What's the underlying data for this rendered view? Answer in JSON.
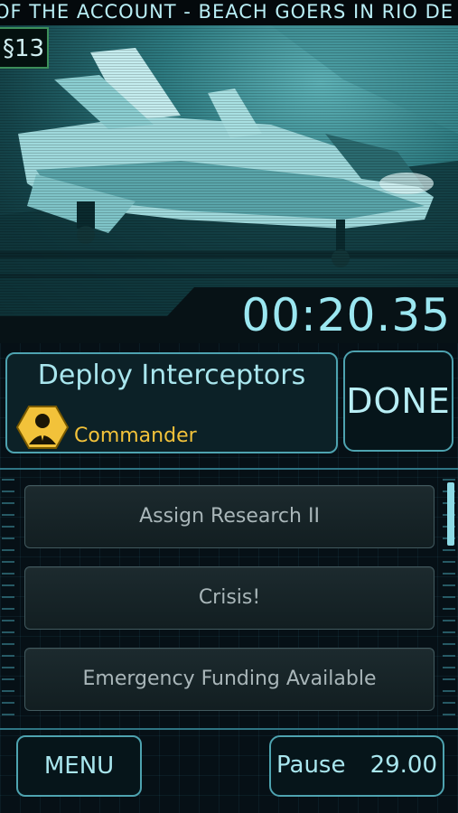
{
  "ticker": {
    "text": "OF THE ACCOUNT - BEACH GOERS IN RIO DE JAN"
  },
  "hud": {
    "money": "§13",
    "timer": "00:20.35"
  },
  "mission": {
    "title": "Deploy Interceptors",
    "rank": "Commander",
    "badge_icon": "commander-badge-icon",
    "accent_color": "#f2c23a"
  },
  "done_button": {
    "label": "DONE"
  },
  "events": [
    {
      "label": "Assign Research II"
    },
    {
      "label": "Crisis!"
    },
    {
      "label": "Emergency Funding Available"
    }
  ],
  "footer": {
    "menu_label": "MENU",
    "pause_label": "Pause",
    "pause_value": "29.00"
  },
  "colors": {
    "accent": "#4ea3b0",
    "text": "#a9e6ee",
    "rank": "#f2c23a"
  }
}
